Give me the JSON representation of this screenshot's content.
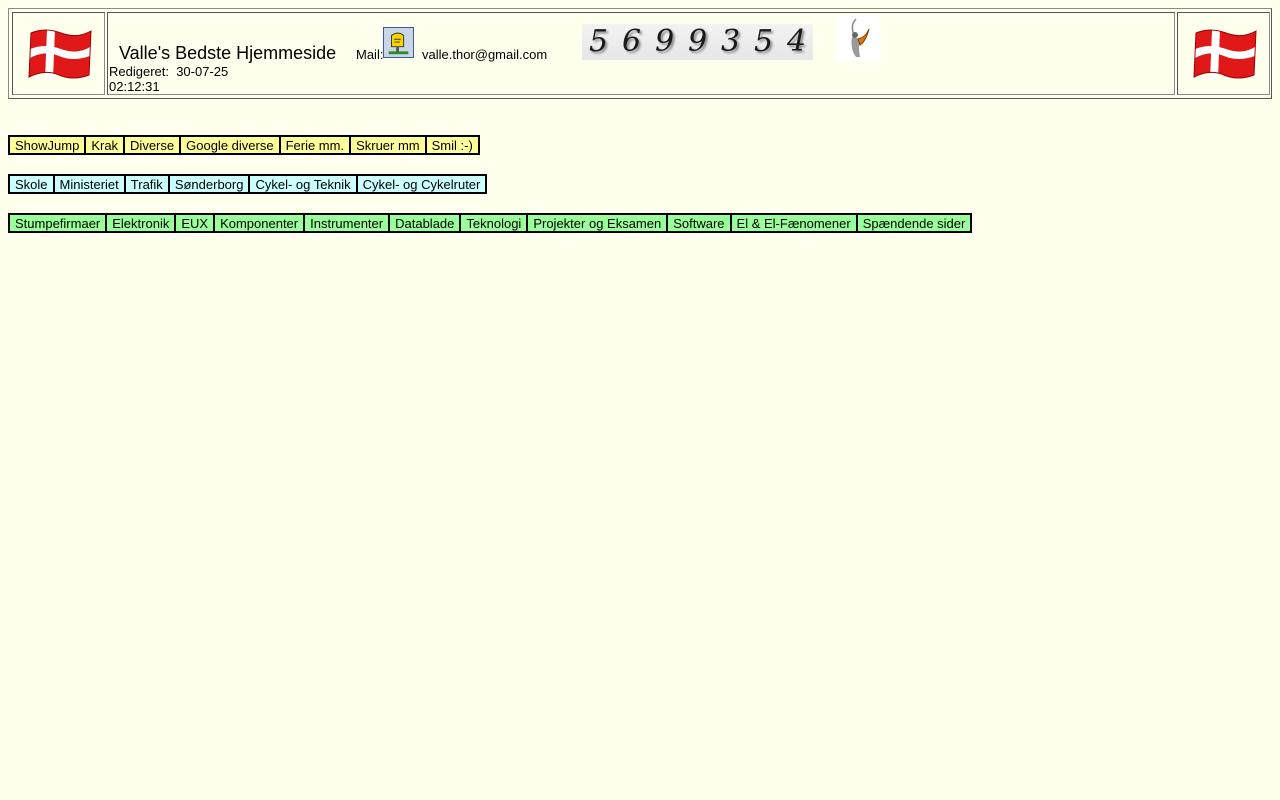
{
  "header": {
    "site_title": "Valle's Bedste Hjemmeside",
    "mail_label": "Mail:",
    "mail_address": "valle.thor@gmail.com",
    "edited_text": "Redigeret:  30-07-25\n02:12:31",
    "counter_digits": [
      "5",
      "6",
      "9",
      "9",
      "3",
      "5",
      "4"
    ],
    "flag_left_icon": "danish-flag-icon",
    "flag_right_icon": "danish-flag-icon",
    "mail_icon": "mailbox-icon",
    "counter_icon": "bird-icon"
  },
  "nav_rows": [
    {
      "color": "#ffff99",
      "items": [
        "ShowJump",
        "Krak",
        "Diverse",
        "Google diverse",
        "Ferie mm.",
        "Skruer mm",
        "Smil :-)"
      ]
    },
    {
      "color": "#ccffff",
      "items": [
        "Skole",
        "Ministeriet",
        "Trafik",
        "Sønderborg",
        "Cykel- og Teknik",
        "Cykel- og Cykelruter"
      ]
    },
    {
      "color": "#99ff99",
      "items": [
        "Stumpefirmaer",
        "Elektronik",
        "EUX",
        "Komponenter",
        "Instrumenter",
        "Datablade",
        "Teknologi",
        "Projekter og Eksamen",
        "Software",
        "El & El-Fænomener",
        "Spændende sider"
      ]
    }
  ],
  "colors": {
    "background": "#ffffee"
  }
}
